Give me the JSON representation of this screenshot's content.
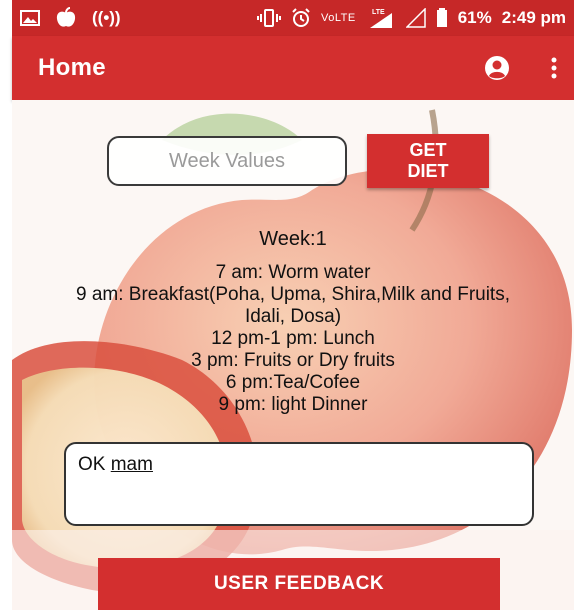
{
  "status_bar": {
    "signal_label": "((•))",
    "volte": "VoLTE",
    "lte": "LTE",
    "battery": "61%",
    "time": "2:49 pm"
  },
  "app_bar": {
    "title": "Home",
    "icons": [
      "account-circle-icon",
      "more-vert-icon"
    ]
  },
  "form": {
    "week_placeholder": "Week Values",
    "get_diet_line1": "GET",
    "get_diet_line2": "DIET"
  },
  "diet": {
    "week_label": "Week:1",
    "schedule": [
      "7 am: Worm water",
      "9 am: Breakfast(Poha, Upma, Shira,Milk and Fruits, Idali, Dosa)",
      "12 pm-1 pm: Lunch",
      "3 pm: Fruits or Dry fruits",
      "6 pm:Tea/Cofee",
      "9 pm: light Dinner"
    ]
  },
  "feedback": {
    "text_prefix": "OK ",
    "text_underlined": "mam",
    "button_label": "USER FEEDBACK"
  },
  "colors": {
    "primary": "#d32f2f",
    "status_bar": "#c62828"
  }
}
